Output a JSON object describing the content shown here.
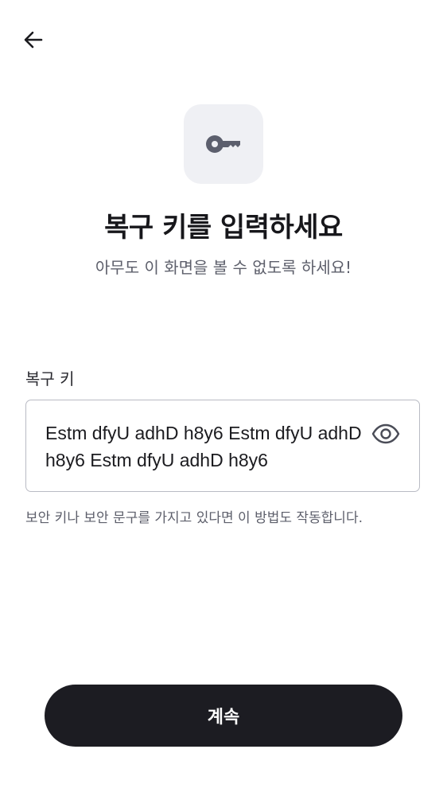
{
  "header": {
    "back_icon": "arrow-left-icon"
  },
  "hero": {
    "icon": "key-icon",
    "title": "복구 키를 입력하세요",
    "subtitle": "아무도 이 화면을 볼 수 없도록 하세요!"
  },
  "recovery_field": {
    "label": "복구 키",
    "value": "Estm dfyU adhD h8y6 Estm dfyU adhD h8y6 Estm dfyU adhD h8y6",
    "visibility_icon": "eye-icon",
    "helper": "보안 키나 보안 문구를 가지고 있다면 이 방법도 작동합니다."
  },
  "footer": {
    "continue_label": "계속"
  },
  "colors": {
    "primary_button": "#1c1c22",
    "icon_tile_bg": "#eff0f4",
    "border": "#b9bbc4",
    "secondary_text": "#5d5f6b"
  }
}
